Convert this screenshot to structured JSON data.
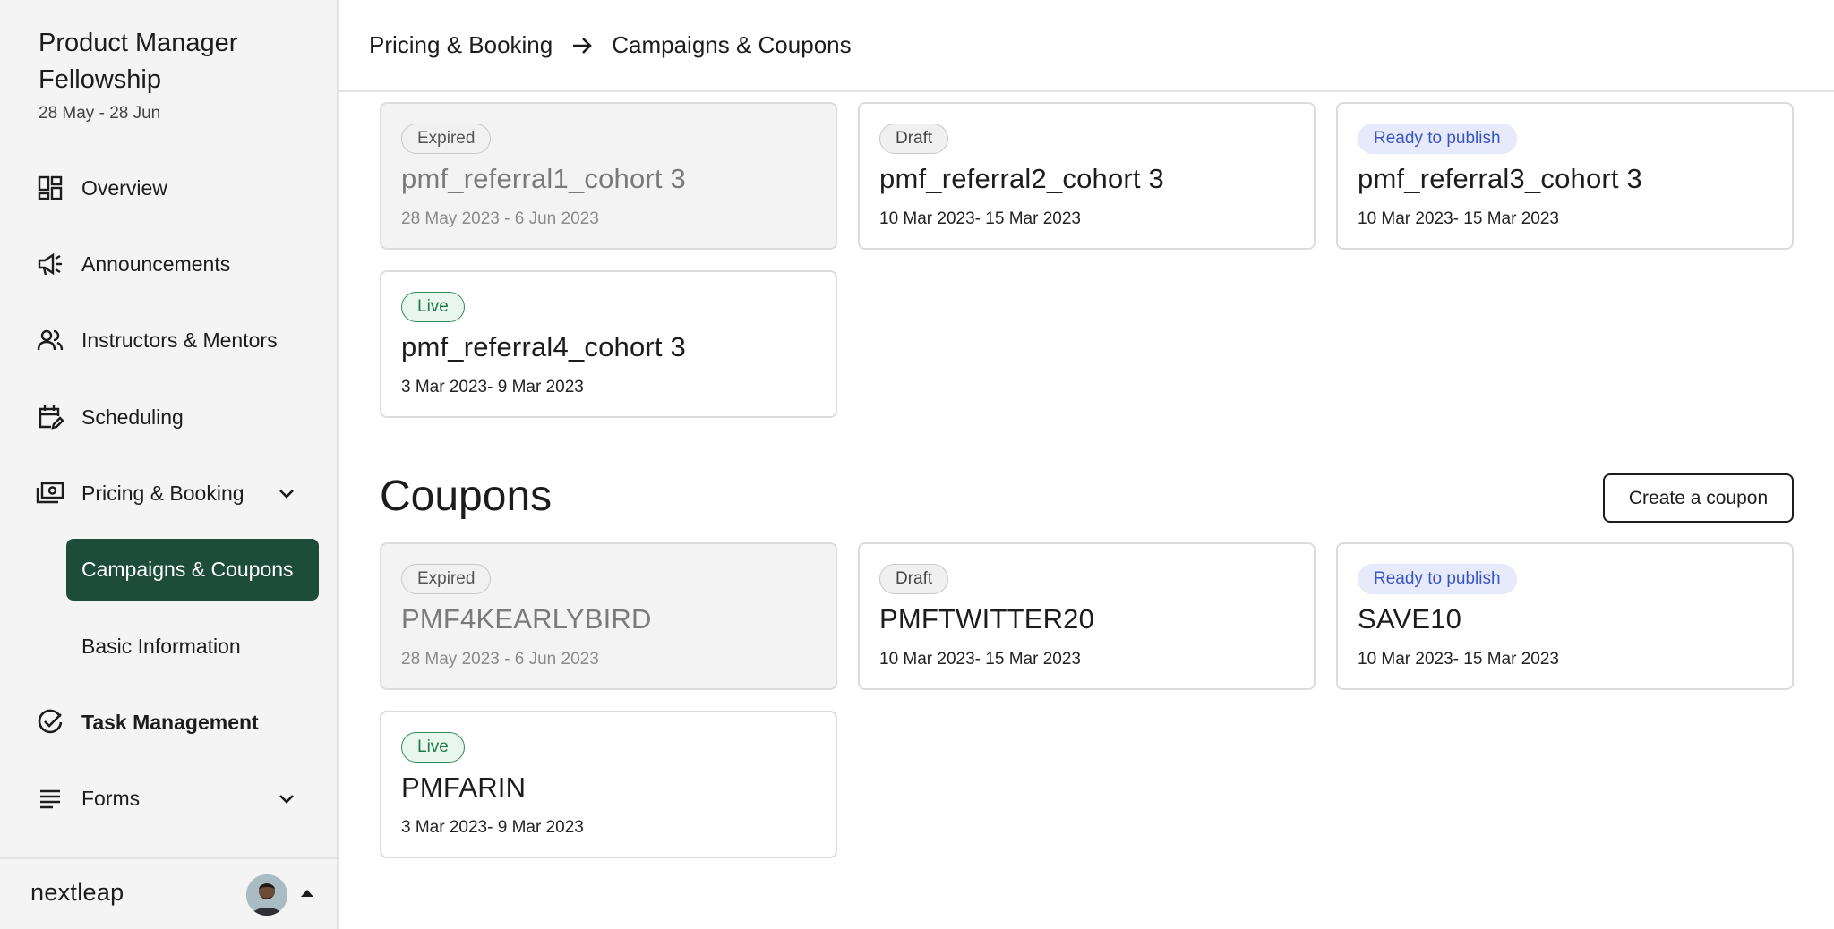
{
  "sidebar": {
    "program_title": "Product Manager Fellowship",
    "program_dates": "28 May - 28 Jun",
    "items": [
      {
        "label": "Overview",
        "icon": "dashboard-icon"
      },
      {
        "label": "Announcements",
        "icon": "megaphone-icon"
      },
      {
        "label": "Instructors & Mentors",
        "icon": "people-icon"
      },
      {
        "label": "Scheduling",
        "icon": "calendar-edit-icon"
      },
      {
        "label": "Pricing & Booking",
        "icon": "money-icon",
        "expanded": true,
        "sub_items": [
          {
            "label": "Campaigns & Coupons",
            "active": true
          },
          {
            "label": "Basic Information",
            "active": false
          }
        ]
      },
      {
        "label": "Task Management",
        "icon": "check-circle-icon"
      },
      {
        "label": "Forms",
        "icon": "list-icon"
      }
    ],
    "brand": "nextleap"
  },
  "header": {
    "crumb_1": "Pricing & Booking",
    "crumb_2": "Campaigns & Coupons"
  },
  "campaigns": [
    {
      "status": "Expired",
      "name": "pmf_referral1_cohort 3",
      "dates": "28 May 2023 - 6 Jun 2023"
    },
    {
      "status": "Draft",
      "name": "pmf_referral2_cohort 3",
      "dates": "10 Mar 2023- 15 Mar 2023"
    },
    {
      "status": "Ready to publish",
      "name": "pmf_referral3_cohort 3",
      "dates": "10 Mar 2023- 15 Mar 2023"
    },
    {
      "status": "Live",
      "name": "pmf_referral4_cohort 3",
      "dates": "3 Mar 2023- 9 Mar 2023"
    }
  ],
  "coupons_section": {
    "title": "Coupons",
    "create_label": "Create a coupon"
  },
  "coupons": [
    {
      "status": "Expired",
      "name": "PMF4KEARLYBIRD",
      "dates": "28 May 2023 - 6 Jun 2023"
    },
    {
      "status": "Draft",
      "name": "PMFTWITTER20",
      "dates": "10 Mar 2023- 15 Mar 2023"
    },
    {
      "status": "Ready to publish",
      "name": "SAVE10",
      "dates": "10 Mar 2023- 15 Mar 2023"
    },
    {
      "status": "Live",
      "name": "PMFARIN",
      "dates": "3 Mar 2023- 9 Mar 2023"
    }
  ],
  "colors": {
    "accent": "#1d4c3a",
    "live": "#1f7a48",
    "ready": "#3a55c3"
  }
}
